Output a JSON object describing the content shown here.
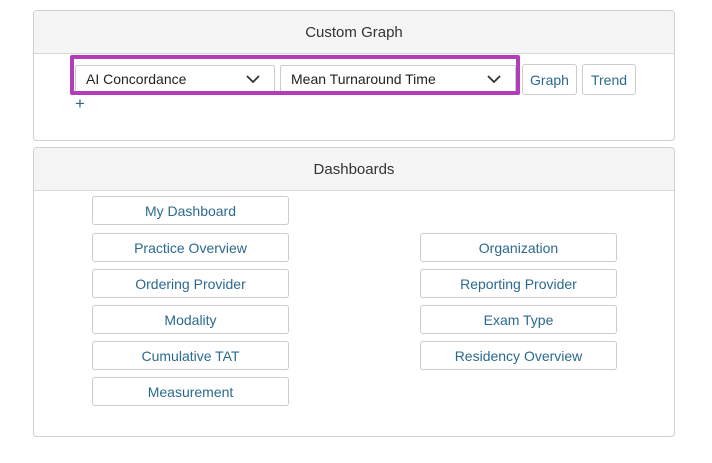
{
  "custom_graph": {
    "title": "Custom Graph",
    "metric_category_select": {
      "selected": "AI Concordance"
    },
    "metric_select": {
      "selected": "Mean Turnaround Time"
    },
    "graph_label": "Graph",
    "trend_label": "Trend",
    "add_symbol": "+"
  },
  "dashboards": {
    "title": "Dashboards",
    "left": [
      "My Dashboard",
      "Practice Overview",
      "Ordering Provider",
      "Modality",
      "Cumulative TAT",
      "Measurement"
    ],
    "right": [
      "Organization",
      "Reporting Provider",
      "Exam Type",
      "Residency Overview"
    ]
  },
  "colors": {
    "accent_text": "#2b6a8e",
    "highlight_border": "#b43cb8",
    "header_bg": "#f5f5f5"
  },
  "icons": {
    "dropdown": "chevron-down-icon",
    "add": "plus-icon"
  }
}
